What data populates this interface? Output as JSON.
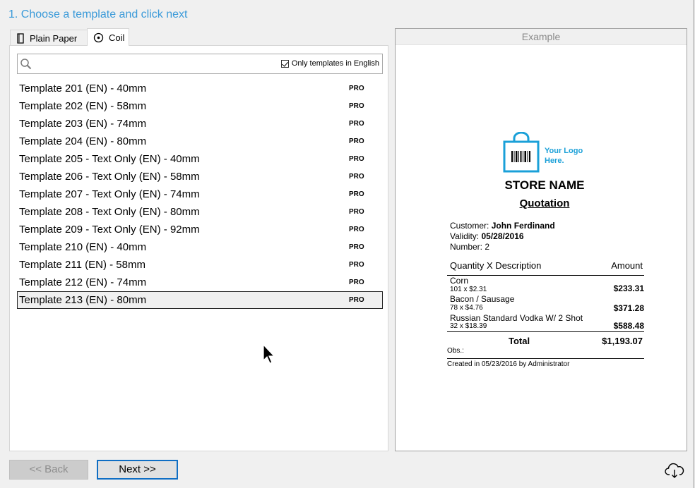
{
  "step": {
    "title": "1. Choose a template and click next"
  },
  "tabs": [
    {
      "label": "Plain Paper",
      "icon": "page-icon",
      "selected": false
    },
    {
      "label": "Coil",
      "icon": "coil-icon",
      "selected": true
    }
  ],
  "search": {
    "value": "",
    "icon": "search-icon",
    "only_english_label": "Only templates in English",
    "only_english_checked": true
  },
  "templates": [
    {
      "name": "Template 201 (EN) - 40mm",
      "badge": "PRO"
    },
    {
      "name": "Template 202 (EN) - 58mm",
      "badge": "PRO"
    },
    {
      "name": "Template 203 (EN) - 74mm",
      "badge": "PRO"
    },
    {
      "name": "Template 204 (EN) - 80mm",
      "badge": "PRO"
    },
    {
      "name": "Template 205 - Text Only (EN) - 40mm",
      "badge": "PRO"
    },
    {
      "name": "Template 206 - Text Only (EN) - 58mm",
      "badge": "PRO"
    },
    {
      "name": "Template 207 - Text Only (EN) - 74mm",
      "badge": "PRO"
    },
    {
      "name": "Template 208 - Text Only (EN) - 80mm",
      "badge": "PRO"
    },
    {
      "name": "Template 209 - Text Only (EN) - 92mm",
      "badge": "PRO"
    },
    {
      "name": "Template 210 (EN) - 40mm",
      "badge": "PRO"
    },
    {
      "name": "Template 211 (EN) - 58mm",
      "badge": "PRO"
    },
    {
      "name": "Template 212 (EN) - 74mm",
      "badge": "PRO"
    },
    {
      "name": "Template 213 (EN) - 80mm",
      "badge": "PRO"
    }
  ],
  "selected_template_index": 12,
  "example": {
    "header": "Example",
    "logo_line1": "Your Logo",
    "logo_line2": "Here.",
    "store_name": "STORE NAME",
    "doc_type": "Quotation",
    "customer_label": "Customer:",
    "customer_value": "John Ferdinand",
    "validity_label": "Validity:",
    "validity_value": "05/28/2016",
    "number_label": "Number:",
    "number_value": "2",
    "col_qty_desc": "Quantity X Description",
    "col_amount": "Amount",
    "items": [
      {
        "name": "Corn",
        "qty": "101 x $2.31",
        "amount": "$233.31"
      },
      {
        "name": "Bacon / Sausage",
        "qty": "78 x $4.76",
        "amount": "$371.28"
      },
      {
        "name": "Russian Standard Vodka W/ 2 Shot",
        "qty": "32 x $18.39",
        "amount": "$588.48"
      }
    ],
    "total_label": "Total",
    "total_value": "$1,193.07",
    "obs_label": "Obs.:",
    "created_text": "Created in 05/23/2016 by Administrator"
  },
  "buttons": {
    "back_label": "<< Back",
    "next_label": "Next >>",
    "back_enabled": false
  },
  "colors": {
    "accent_blue": "#3a9ad9",
    "logo_blue": "#1aa0d8",
    "next_border": "#0f6ec4"
  }
}
